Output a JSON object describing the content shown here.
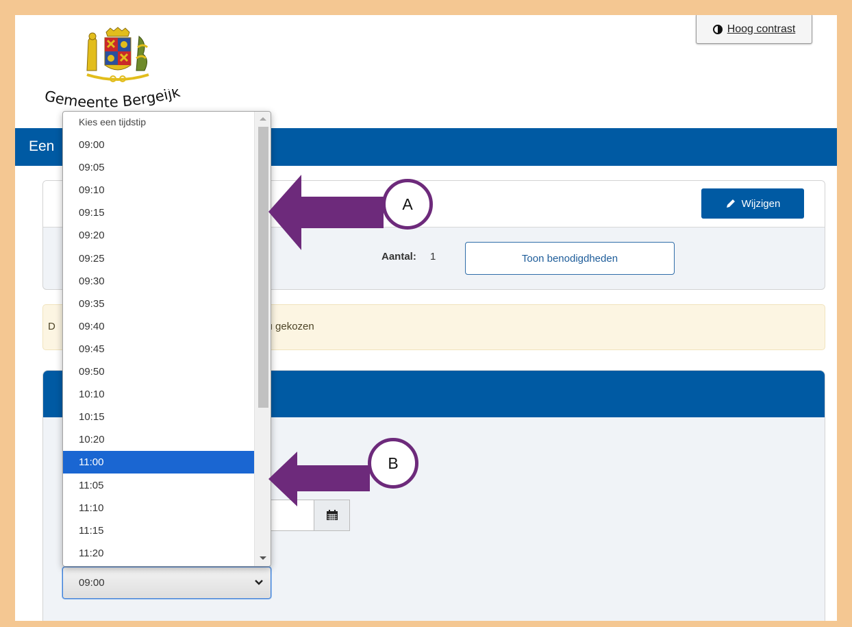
{
  "header": {
    "contrast_label": "Hoog contrast",
    "logo_text": "Gemeente Bergeijk"
  },
  "banner": {
    "title_partial": "Een"
  },
  "panel": {
    "edit_label": "Wijzigen",
    "aantal_label": "Aantal:",
    "aantal_value": "1",
    "toon_label": "Toon benodigdheden"
  },
  "alert": {
    "prefix": "D",
    "text_partial": "or u gekozen"
  },
  "time_select": {
    "selected_value": "09:00",
    "placeholder": "Kies een tijdstip",
    "highlighted": "11:00",
    "options": [
      "09:00",
      "09:05",
      "09:10",
      "09:15",
      "09:20",
      "09:25",
      "09:30",
      "09:35",
      "09:40",
      "09:45",
      "09:50",
      "10:10",
      "10:15",
      "10:20",
      "11:00",
      "11:05",
      "11:10",
      "11:15",
      "11:20"
    ]
  },
  "annotations": {
    "a": "A",
    "b": "B",
    "arrow_color": "#6d2a7b"
  },
  "colors": {
    "primary": "#005aa3",
    "highlight": "#1a66d2",
    "frame": "#f4c792"
  }
}
